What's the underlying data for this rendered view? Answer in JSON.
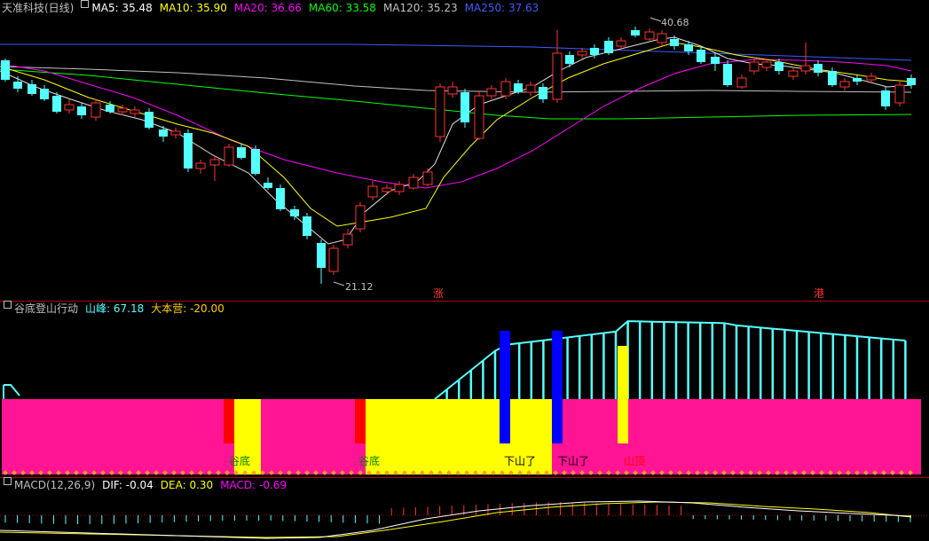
{
  "main_panel": {
    "title": "天准科技(日线)",
    "ma": [
      {
        "label": "MA5: 35.48",
        "color": "#ffffff"
      },
      {
        "label": "MA10: 35.90",
        "color": "#ffff00"
      },
      {
        "label": "MA20: 36.66",
        "color": "#ff00ff"
      },
      {
        "label": "MA60: 33.58",
        "color": "#00ff00"
      },
      {
        "label": "MA120: 35.23",
        "color": "#c0c0c0"
      },
      {
        "label": "MA250: 37.63",
        "color": "#3a5cff"
      }
    ],
    "high_label": "40.68",
    "low_label": "21.12",
    "marker_zhang": "涨",
    "marker_gang": "港"
  },
  "indicator_panel": {
    "title": "谷底登山行动",
    "shanfeng_label": "山峰: 67.18",
    "dabenying_label": "大本营: -20.00",
    "labels": {
      "gudi1": "谷底",
      "gudi2": "谷底",
      "xiashan1": "下山了",
      "xiashan2": "下山了",
      "shanding": "山顶"
    }
  },
  "macd_panel": {
    "title": "MACD(12,26,9)",
    "dif_label": "DIF: -0.04",
    "dea_label": "DEA: 0.30",
    "macd_label": "MACD: -0.69"
  },
  "colors": {
    "up": "#ff3232",
    "down": "#54ffff",
    "magenta_band": "#ff1493",
    "yellow_band": "#ffff00",
    "blue_bar": "#0000ff",
    "separator": "#b00000"
  }
}
